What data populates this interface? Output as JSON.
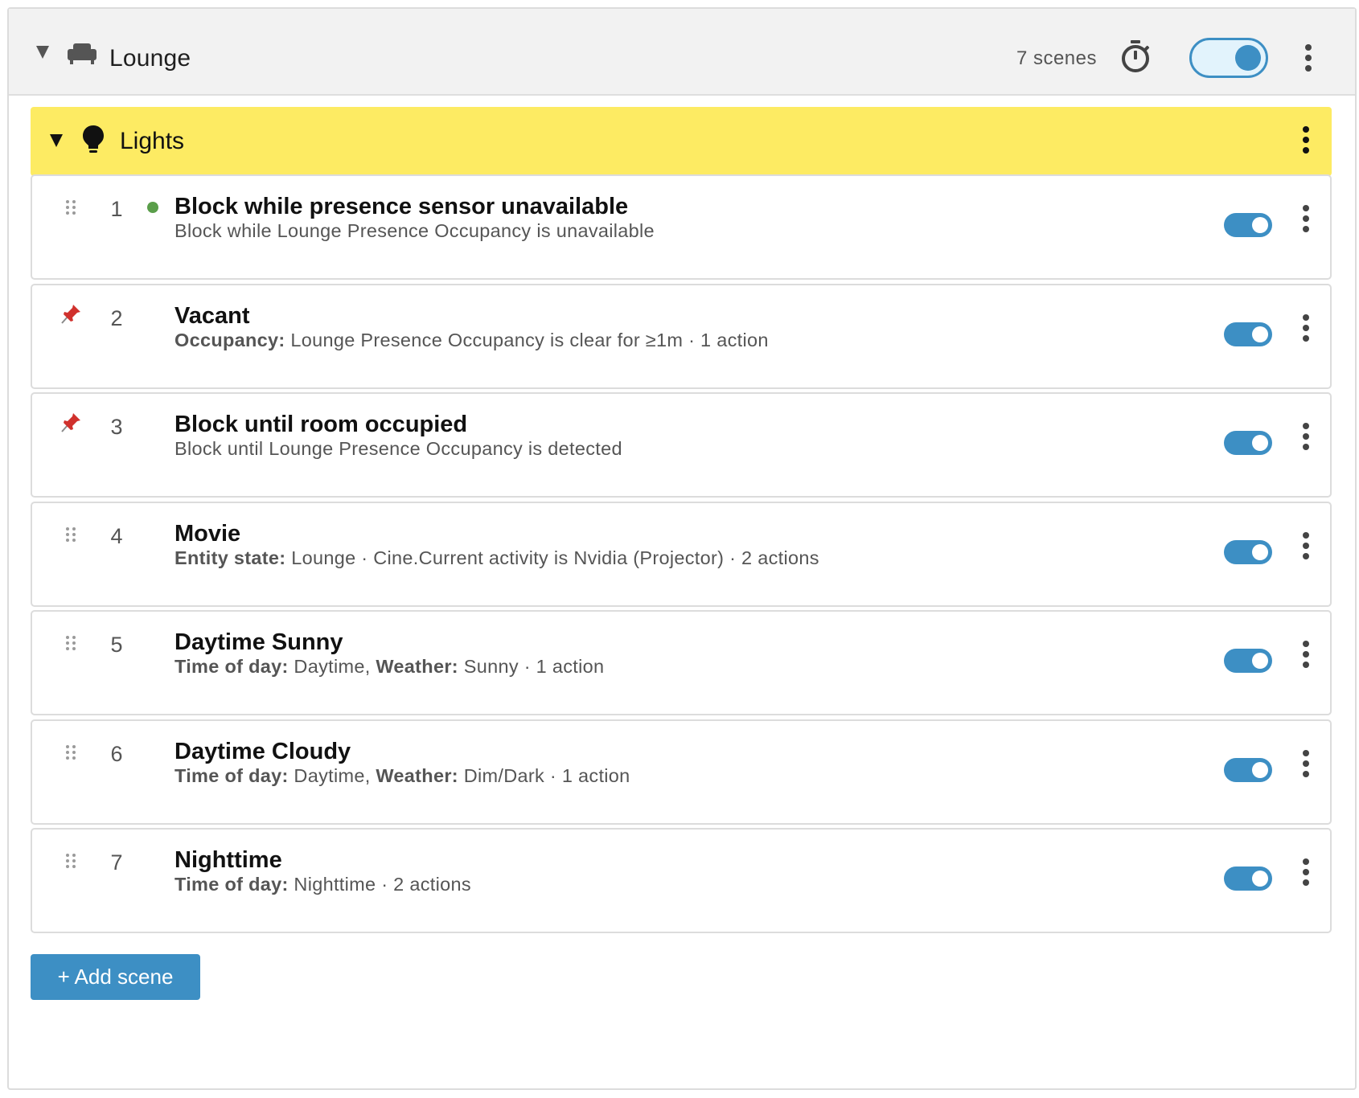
{
  "room": {
    "title": "Lounge",
    "scene_count": "7 scenes",
    "enabled": true
  },
  "group": {
    "title": "Lights",
    "color": "#fdeb63"
  },
  "scenes": [
    {
      "number": "1",
      "title": "Block while presence sensor unavailable",
      "desc": [
        {
          "t": "Block while Lounge Presence Occupancy is unavailable"
        }
      ],
      "handle": "drag",
      "status_dot": true,
      "enabled": true
    },
    {
      "number": "2",
      "title": "Vacant",
      "desc": [
        {
          "t": "Occupancy:",
          "b": true
        },
        {
          "t": " Lounge Presence Occupancy is clear for ≥1m · 1 action"
        }
      ],
      "handle": "pin",
      "status_dot": false,
      "enabled": true
    },
    {
      "number": "3",
      "title": "Block until room occupied",
      "desc": [
        {
          "t": "Block until Lounge Presence Occupancy is detected"
        }
      ],
      "handle": "pin",
      "status_dot": false,
      "enabled": true
    },
    {
      "number": "4",
      "title": "Movie",
      "desc": [
        {
          "t": "Entity state:",
          "b": true
        },
        {
          "t": " Lounge · Cine.Current activity is Nvidia (Projector) · 2 actions"
        }
      ],
      "handle": "drag",
      "status_dot": false,
      "enabled": true
    },
    {
      "number": "5",
      "title": "Daytime Sunny",
      "desc": [
        {
          "t": "Time of day:",
          "b": true
        },
        {
          "t": " Daytime, "
        },
        {
          "t": "Weather:",
          "b": true
        },
        {
          "t": " Sunny · 1 action"
        }
      ],
      "handle": "drag",
      "status_dot": false,
      "enabled": true
    },
    {
      "number": "6",
      "title": "Daytime Cloudy",
      "desc": [
        {
          "t": "Time of day:",
          "b": true
        },
        {
          "t": " Daytime, "
        },
        {
          "t": "Weather:",
          "b": true
        },
        {
          "t": " Dim/Dark · 1 action"
        }
      ],
      "handle": "drag",
      "status_dot": false,
      "enabled": true
    },
    {
      "number": "7",
      "title": "Nighttime",
      "desc": [
        {
          "t": "Time of day:",
          "b": true
        },
        {
          "t": " Nighttime · 2 actions"
        }
      ],
      "handle": "drag",
      "status_dot": false,
      "enabled": true
    }
  ],
  "add_scene_label": "+ Add scene",
  "colors": {
    "accent": "#3d8fc4",
    "status_green": "#5a9e4a",
    "pin_red": "#d0312d"
  },
  "icons": {
    "room": "sofa-icon",
    "timer": "timer-icon",
    "group": "lightbulb-icon",
    "menu": "kebab-icon",
    "drag": "drag-handle-icon",
    "pin": "pin-icon"
  }
}
